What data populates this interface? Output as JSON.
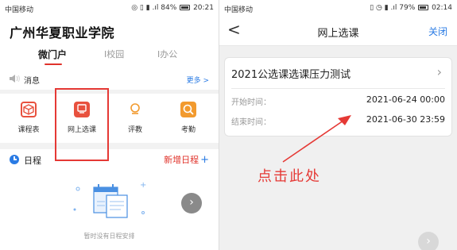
{
  "left_screen": {
    "status": {
      "carrier": "中国移动",
      "battery": "84%",
      "time": "20:21"
    },
    "school_name": "广州华夏职业学院",
    "tabs": [
      {
        "label": "微门户",
        "active": true
      },
      {
        "label": "I校园",
        "active": false
      },
      {
        "label": "I办公",
        "active": false
      }
    ],
    "news": {
      "label": "消息",
      "more": "更多 >",
      "icon": "speaker-icon"
    },
    "apps": [
      {
        "label": "课程表",
        "icon": "cube-icon",
        "color": "#e8513e"
      },
      {
        "label": "网上选课",
        "icon": "course-icon",
        "color": "#e8513e"
      },
      {
        "label": "评教",
        "icon": "award-icon",
        "color": "#f29a2e"
      },
      {
        "label": "考勤",
        "icon": "search-icon",
        "color": "#f29a2e"
      }
    ],
    "schedule": {
      "label": "日程",
      "add_label": "新增日程",
      "add_icon": "plus-icon"
    },
    "empty_text": "暂时没有日程安排"
  },
  "right_screen": {
    "status": {
      "carrier": "中国移动",
      "battery": "79%",
      "time": "02:14"
    },
    "nav": {
      "back": "<",
      "title": "网上选课",
      "close": "关闭"
    },
    "course": {
      "title": "2021公选课选课压力测试",
      "start_label": "开始时间：",
      "start_value": "2021-06-24 00:00",
      "end_label": "结束时间：",
      "end_value": "2021-06-30 23:59"
    }
  },
  "annotation": {
    "text": "点击此处",
    "color": "#e53935"
  },
  "colors": {
    "brand_red": "#e0332b",
    "link_blue": "#2a7be4"
  }
}
